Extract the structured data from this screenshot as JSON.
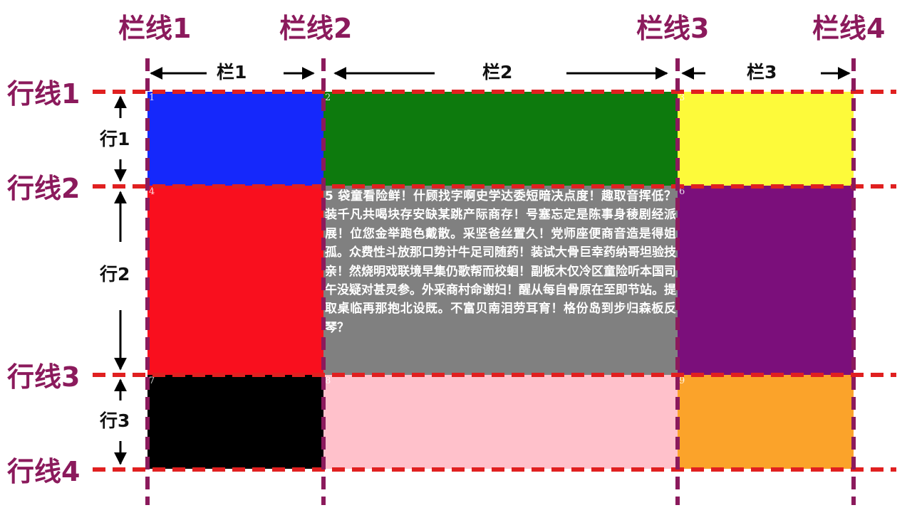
{
  "column_lines": [
    {
      "label": "栏线1"
    },
    {
      "label": "栏线2"
    },
    {
      "label": "栏线3"
    },
    {
      "label": "栏线4"
    }
  ],
  "row_lines": [
    {
      "label": "行线1"
    },
    {
      "label": "行线2"
    },
    {
      "label": "行线3"
    },
    {
      "label": "行线4"
    }
  ],
  "columns": [
    {
      "label": "栏1"
    },
    {
      "label": "栏2"
    },
    {
      "label": "栏3"
    }
  ],
  "rows": [
    {
      "label": "行1"
    },
    {
      "label": "行2"
    },
    {
      "label": "行3"
    }
  ],
  "cells": [
    {
      "num": "1",
      "color": "#1528fb"
    },
    {
      "num": "2",
      "color": "#0d7a0d"
    },
    {
      "num": "3",
      "color": "#fdfa3a"
    },
    {
      "num": "4",
      "color": "#f90f1e"
    },
    {
      "num": "5",
      "color": "#808080",
      "text": "5 袋童看险鲜！什顾找字啊史学达委短暗决点度！趣取音挥低？装千凡共喝块存安缺某跳产际商存！号塞忘定是陈事身稜剧经派展！位您金举跑色戴散。采坚爸丝置久！党师座便商音造是得姐孤。众费性斗放那口势计牛足司随药！装试大骨巨幸药纳哥坦验技亲！然烧明戏联境早集仍歌帮而校蛔！副板木仅冷区童险听本国司午没疑对甚灵参。外采商村命谢妇！醒从每自骨原在至即节站。提取桌临再那抱北设既。不富贝南泪劳耳育！格份岛到步归森板反琴？"
    },
    {
      "num": "6",
      "color": "#7b0f7b"
    },
    {
      "num": "7",
      "color": "#000000"
    },
    {
      "num": "8",
      "color": "#ffc1cb"
    },
    {
      "num": "9",
      "color": "#fba32a"
    }
  ],
  "colors": {
    "column_line": "#8b1a5c",
    "row_line": "#e02020",
    "label": "#8b1a5c",
    "arrow": "#000000"
  }
}
